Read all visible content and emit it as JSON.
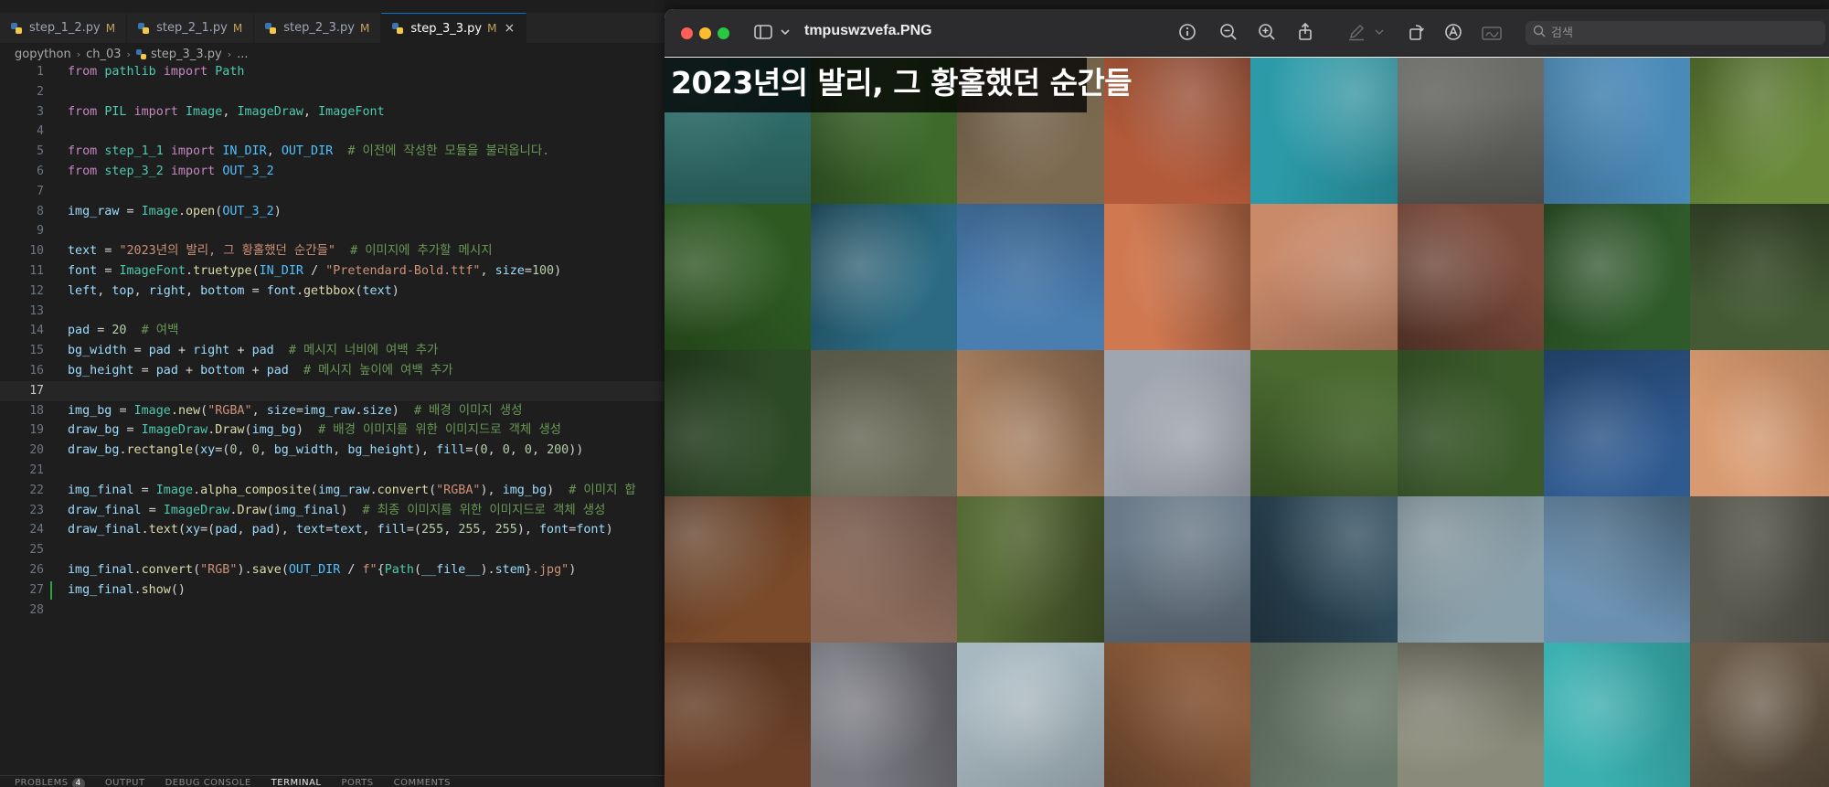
{
  "editor": {
    "tabs": [
      {
        "label": "step_1_2.py",
        "modified": "M",
        "active": false
      },
      {
        "label": "step_2_1.py",
        "modified": "M",
        "active": false
      },
      {
        "label": "step_2_3.py",
        "modified": "M",
        "active": false
      },
      {
        "label": "step_3_3.py",
        "modified": "M",
        "active": true
      }
    ],
    "close_glyph": "×",
    "breadcrumb": [
      "gopython",
      "ch_03",
      "step_3_3.py",
      "..."
    ],
    "current_line": 17,
    "git_modified_line": 27,
    "lines": [
      [
        [
          "kw",
          "from "
        ],
        [
          "cls",
          "pathlib "
        ],
        [
          "kw",
          "import "
        ],
        [
          "cls",
          "Path"
        ]
      ],
      [],
      [
        [
          "kw",
          "from "
        ],
        [
          "cls",
          "PIL "
        ],
        [
          "kw",
          "import "
        ],
        [
          "cls",
          "Image"
        ],
        [
          "op",
          ", "
        ],
        [
          "cls",
          "ImageDraw"
        ],
        [
          "op",
          ", "
        ],
        [
          "cls",
          "ImageFont"
        ]
      ],
      [],
      [
        [
          "kw",
          "from "
        ],
        [
          "cls",
          "step_1_1 "
        ],
        [
          "kw",
          "import "
        ],
        [
          "const",
          "IN_DIR"
        ],
        [
          "op",
          ", "
        ],
        [
          "const",
          "OUT_DIR"
        ],
        [
          "op",
          "  "
        ],
        [
          "com",
          "# 이전에 작성한 모듈을 불러옵니다."
        ]
      ],
      [
        [
          "kw",
          "from "
        ],
        [
          "cls",
          "step_3_2 "
        ],
        [
          "kw",
          "import "
        ],
        [
          "const",
          "OUT_3_2"
        ]
      ],
      [],
      [
        [
          "var",
          "img_raw "
        ],
        [
          "op",
          "= "
        ],
        [
          "cls",
          "Image"
        ],
        [
          "op",
          "."
        ],
        [
          "fn",
          "open"
        ],
        [
          "op",
          "("
        ],
        [
          "const",
          "OUT_3_2"
        ],
        [
          "op",
          ")"
        ]
      ],
      [],
      [
        [
          "var",
          "text "
        ],
        [
          "op",
          "= "
        ],
        [
          "str",
          "\"2023년의 발리, 그 황홀했던 순간들\""
        ],
        [
          "op",
          "  "
        ],
        [
          "com",
          "# 이미지에 추가할 메시지"
        ]
      ],
      [
        [
          "var",
          "font "
        ],
        [
          "op",
          "= "
        ],
        [
          "cls",
          "ImageFont"
        ],
        [
          "op",
          "."
        ],
        [
          "fn",
          "truetype"
        ],
        [
          "op",
          "("
        ],
        [
          "const",
          "IN_DIR "
        ],
        [
          "op",
          "/ "
        ],
        [
          "str",
          "\"Pretendard-Bold.ttf\""
        ],
        [
          "op",
          ", "
        ],
        [
          "var",
          "size"
        ],
        [
          "op",
          "="
        ],
        [
          "num",
          "100"
        ],
        [
          "op",
          ")"
        ]
      ],
      [
        [
          "var",
          "left"
        ],
        [
          "op",
          ", "
        ],
        [
          "var",
          "top"
        ],
        [
          "op",
          ", "
        ],
        [
          "var",
          "right"
        ],
        [
          "op",
          ", "
        ],
        [
          "var",
          "bottom "
        ],
        [
          "op",
          "= "
        ],
        [
          "var",
          "font"
        ],
        [
          "op",
          "."
        ],
        [
          "fn",
          "getbbox"
        ],
        [
          "op",
          "("
        ],
        [
          "var",
          "text"
        ],
        [
          "op",
          ")"
        ]
      ],
      [],
      [
        [
          "var",
          "pad "
        ],
        [
          "op",
          "= "
        ],
        [
          "num",
          "20"
        ],
        [
          "op",
          "  "
        ],
        [
          "com",
          "# 여백"
        ]
      ],
      [
        [
          "var",
          "bg_width "
        ],
        [
          "op",
          "= "
        ],
        [
          "var",
          "pad "
        ],
        [
          "op",
          "+ "
        ],
        [
          "var",
          "right "
        ],
        [
          "op",
          "+ "
        ],
        [
          "var",
          "pad"
        ],
        [
          "op",
          "  "
        ],
        [
          "com",
          "# 메시지 너비에 여백 추가"
        ]
      ],
      [
        [
          "var",
          "bg_height "
        ],
        [
          "op",
          "= "
        ],
        [
          "var",
          "pad "
        ],
        [
          "op",
          "+ "
        ],
        [
          "var",
          "bottom "
        ],
        [
          "op",
          "+ "
        ],
        [
          "var",
          "pad"
        ],
        [
          "op",
          "  "
        ],
        [
          "com",
          "# 메시지 높이에 여백 추가"
        ]
      ],
      [],
      [
        [
          "var",
          "img_bg "
        ],
        [
          "op",
          "= "
        ],
        [
          "cls",
          "Image"
        ],
        [
          "op",
          "."
        ],
        [
          "fn",
          "new"
        ],
        [
          "op",
          "("
        ],
        [
          "str",
          "\"RGBA\""
        ],
        [
          "op",
          ", "
        ],
        [
          "var",
          "size"
        ],
        [
          "op",
          "="
        ],
        [
          "var",
          "img_raw"
        ],
        [
          "op",
          "."
        ],
        [
          "var",
          "size"
        ],
        [
          "op",
          ")"
        ],
        [
          "op",
          "  "
        ],
        [
          "com",
          "# 배경 이미지 생성"
        ]
      ],
      [
        [
          "var",
          "draw_bg "
        ],
        [
          "op",
          "= "
        ],
        [
          "cls",
          "ImageDraw"
        ],
        [
          "op",
          "."
        ],
        [
          "fn",
          "Draw"
        ],
        [
          "op",
          "("
        ],
        [
          "var",
          "img_bg"
        ],
        [
          "op",
          ")"
        ],
        [
          "op",
          "  "
        ],
        [
          "com",
          "# 배경 이미지를 위한 이미지드로 객체 생성"
        ]
      ],
      [
        [
          "var",
          "draw_bg"
        ],
        [
          "op",
          "."
        ],
        [
          "fn",
          "rectangle"
        ],
        [
          "op",
          "("
        ],
        [
          "var",
          "xy"
        ],
        [
          "op",
          "=("
        ],
        [
          "num",
          "0"
        ],
        [
          "op",
          ", "
        ],
        [
          "num",
          "0"
        ],
        [
          "op",
          ", "
        ],
        [
          "var",
          "bg_width"
        ],
        [
          "op",
          ", "
        ],
        [
          "var",
          "bg_height"
        ],
        [
          "op",
          "), "
        ],
        [
          "var",
          "fill"
        ],
        [
          "op",
          "=("
        ],
        [
          "num",
          "0"
        ],
        [
          "op",
          ", "
        ],
        [
          "num",
          "0"
        ],
        [
          "op",
          ", "
        ],
        [
          "num",
          "0"
        ],
        [
          "op",
          ", "
        ],
        [
          "num",
          "200"
        ],
        [
          "op",
          "))"
        ]
      ],
      [],
      [
        [
          "var",
          "img_final "
        ],
        [
          "op",
          "= "
        ],
        [
          "cls",
          "Image"
        ],
        [
          "op",
          "."
        ],
        [
          "fn",
          "alpha_composite"
        ],
        [
          "op",
          "("
        ],
        [
          "var",
          "img_raw"
        ],
        [
          "op",
          "."
        ],
        [
          "fn",
          "convert"
        ],
        [
          "op",
          "("
        ],
        [
          "str",
          "\"RGBA\""
        ],
        [
          "op",
          "), "
        ],
        [
          "var",
          "img_bg"
        ],
        [
          "op",
          ")"
        ],
        [
          "op",
          "  "
        ],
        [
          "com",
          "# 이미지 합"
        ]
      ],
      [
        [
          "var",
          "draw_final "
        ],
        [
          "op",
          "= "
        ],
        [
          "cls",
          "ImageDraw"
        ],
        [
          "op",
          "."
        ],
        [
          "fn",
          "Draw"
        ],
        [
          "op",
          "("
        ],
        [
          "var",
          "img_final"
        ],
        [
          "op",
          ")"
        ],
        [
          "op",
          "  "
        ],
        [
          "com",
          "# 최종 이미지를 위한 이미지드로 객체 생성"
        ]
      ],
      [
        [
          "var",
          "draw_final"
        ],
        [
          "op",
          "."
        ],
        [
          "fn",
          "text"
        ],
        [
          "op",
          "("
        ],
        [
          "var",
          "xy"
        ],
        [
          "op",
          "=("
        ],
        [
          "var",
          "pad"
        ],
        [
          "op",
          ", "
        ],
        [
          "var",
          "pad"
        ],
        [
          "op",
          "), "
        ],
        [
          "var",
          "text"
        ],
        [
          "op",
          "="
        ],
        [
          "var",
          "text"
        ],
        [
          "op",
          ", "
        ],
        [
          "var",
          "fill"
        ],
        [
          "op",
          "=("
        ],
        [
          "num",
          "255"
        ],
        [
          "op",
          ", "
        ],
        [
          "num",
          "255"
        ],
        [
          "op",
          ", "
        ],
        [
          "num",
          "255"
        ],
        [
          "op",
          "), "
        ],
        [
          "var",
          "font"
        ],
        [
          "op",
          "="
        ],
        [
          "var",
          "font"
        ],
        [
          "op",
          ")"
        ]
      ],
      [],
      [
        [
          "var",
          "img_final"
        ],
        [
          "op",
          "."
        ],
        [
          "fn",
          "convert"
        ],
        [
          "op",
          "("
        ],
        [
          "str",
          "\"RGB\""
        ],
        [
          "op",
          ")."
        ],
        [
          "fn",
          "save"
        ],
        [
          "op",
          "("
        ],
        [
          "const",
          "OUT_DIR "
        ],
        [
          "op",
          "/ "
        ],
        [
          "str",
          "f\""
        ],
        [
          "op",
          "{"
        ],
        [
          "cls",
          "Path"
        ],
        [
          "op",
          "("
        ],
        [
          "var",
          "__file__"
        ],
        [
          "op",
          ")."
        ],
        [
          "var",
          "stem"
        ],
        [
          "op",
          "}"
        ],
        [
          "str",
          ".jpg\""
        ],
        [
          "op",
          ")"
        ]
      ],
      [
        [
          "var",
          "img_final"
        ],
        [
          "op",
          "."
        ],
        [
          "fn",
          "show"
        ],
        [
          "op",
          "()"
        ]
      ],
      []
    ],
    "panel_tabs": [
      {
        "label": "PROBLEMS",
        "badge": "4"
      },
      {
        "label": "OUTPUT",
        "badge": ""
      },
      {
        "label": "DEBUG CONSOLE",
        "badge": ""
      },
      {
        "label": "TERMINAL",
        "badge": ""
      },
      {
        "label": "PORTS",
        "badge": ""
      },
      {
        "label": "COMMENTS",
        "badge": ""
      }
    ],
    "active_panel_tab": "TERMINAL"
  },
  "preview": {
    "title": "tmpuswzvefa.PNG",
    "search_placeholder": "검색",
    "overlay_text": "2023년의 발리, 그 황홀했던 순간들",
    "toolbar_icons": [
      "sidebar-toggle-icon",
      "info-icon",
      "zoom-out-icon",
      "zoom-in-icon",
      "share-icon",
      "markup-pen-icon",
      "rotate-icon",
      "annotate-icon",
      "signature-icon"
    ],
    "tile_colors": [
      [
        "#2f6d6a",
        "#3e6b2c",
        "#7c6a50",
        "#b35a3a",
        "#2c9aa8",
        "#6a6a66",
        "#4a8ab8",
        "#6a8a3a"
      ],
      [
        "#2e5a22",
        "#2b6a82",
        "#4a7db0",
        "#d07850",
        "#c98a6a",
        "#7a4a3a",
        "#2f5a2a",
        "#445a34"
      ],
      [
        "#2d4a26",
        "#6a6a58",
        "#a88060",
        "#a0a6b0",
        "#4a6a30",
        "#3a5a2a",
        "#2f5a90",
        "#d89a70"
      ],
      [
        "#7a4a2a",
        "#8a6a5a",
        "#556a34",
        "#6a7a88",
        "#2e4a5a",
        "#8aa0aa",
        "#6a90b0",
        "#5a5a50"
      ],
      [
        "#6a4028",
        "#7a7a82",
        "#a8b8c0",
        "#8a5a3a",
        "#6a7a6a",
        "#8a8a7a",
        "#3ab0b0",
        "#6a5a48"
      ]
    ]
  }
}
